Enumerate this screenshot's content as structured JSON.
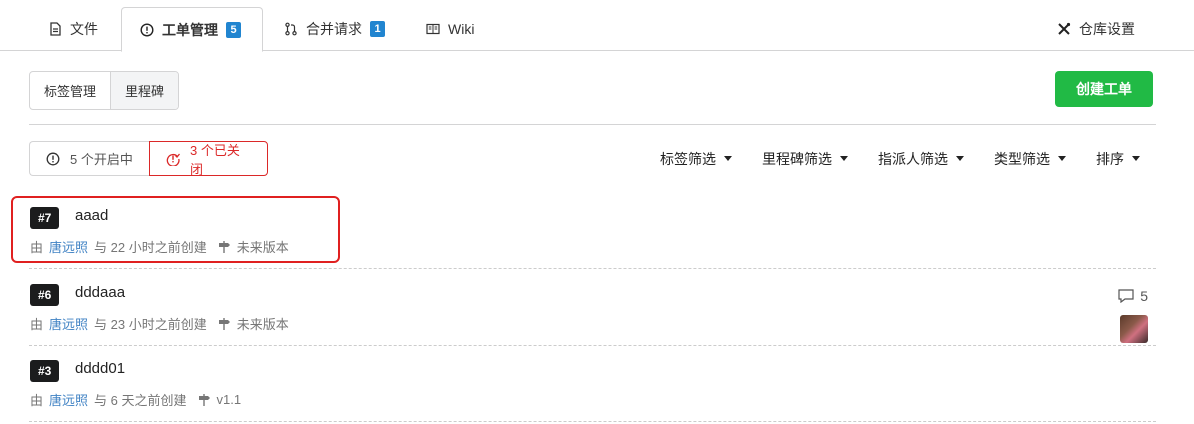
{
  "tabs": [
    {
      "label": "文件",
      "icon": "file-icon"
    },
    {
      "label": "工单管理",
      "icon": "issue-opened-icon",
      "count": "5"
    },
    {
      "label": "合并请求",
      "icon": "git-pull-request-icon",
      "count": "1"
    },
    {
      "label": "Wiki",
      "icon": "book-icon"
    },
    {
      "label": "仓库设置",
      "icon": "tools-icon"
    }
  ],
  "toolbar": {
    "labels_button": "标签管理",
    "milestones_button": "里程碑",
    "create_button": "创建工单"
  },
  "state": {
    "open_label": "5 个开启中",
    "closed_label": "3 个已关闭"
  },
  "filters": [
    "标签筛选",
    "里程碑筛选",
    "指派人筛选",
    "类型筛选",
    "排序"
  ],
  "issues": [
    {
      "number": "#7",
      "title": "aaad",
      "by": "由",
      "author": "唐远照",
      "created": "与 22 小时之前创建",
      "milestone": "未来版本"
    },
    {
      "number": "#6",
      "title": "dddaaa",
      "by": "由",
      "author": "唐远照",
      "created": "与 23 小时之前创建",
      "milestone": "未来版本",
      "comments": "5"
    },
    {
      "number": "#3",
      "title": "dddd01",
      "by": "由",
      "author": "唐远照",
      "created": "与 6 天之前创建",
      "milestone": "v1.1"
    }
  ],
  "colors": {
    "accent_blue": "#2185d0",
    "create_green": "#21ba45",
    "closed_red": "#db2828",
    "highlight_red": "#e02020"
  }
}
